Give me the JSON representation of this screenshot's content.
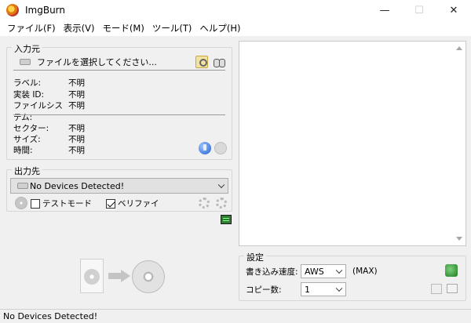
{
  "window": {
    "title": "ImgBurn",
    "minimize": "—",
    "maximize": "☐",
    "close": "✕"
  },
  "menu": [
    "ファイル(F)",
    "表示(V)",
    "モード(M)",
    "ツール(T)",
    "ヘルプ(H)"
  ],
  "source": {
    "title": "入力元",
    "placeholder": "ファイルを選択してください...",
    "fields": [
      {
        "label": "ラベル:",
        "value": "不明"
      },
      {
        "label": "実装 ID:",
        "value": "不明"
      },
      {
        "label": "ファイルシステム:",
        "value": "不明"
      },
      {
        "label": "セクター:",
        "value": "不明"
      },
      {
        "label": "サイズ:",
        "value": "不明"
      },
      {
        "label": "時間:",
        "value": "不明"
      }
    ]
  },
  "destination": {
    "title": "出力先",
    "device": "No Devices Detected!",
    "test_mode": {
      "label": "テストモード",
      "checked": false
    },
    "verify": {
      "label": "ベリファイ",
      "checked": true
    }
  },
  "settings": {
    "title": "設定",
    "speed_label": "書き込み速度:",
    "speed_value": "AWS",
    "speed_max": "(MAX)",
    "copies_label": "コピー数:",
    "copies_value": "1"
  },
  "status": "No Devices Detected!"
}
